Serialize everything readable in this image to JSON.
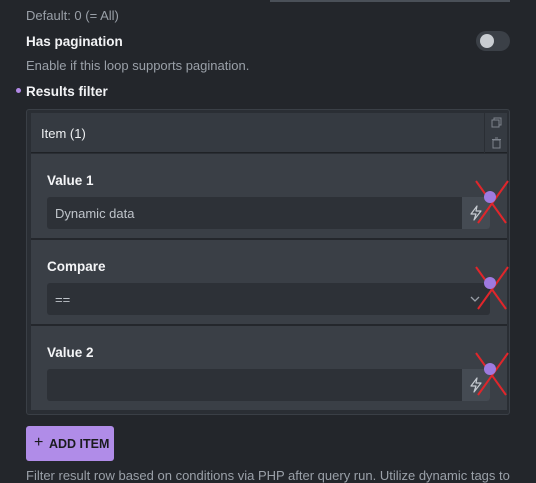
{
  "top": {
    "default_text": "Default: 0 (= All)"
  },
  "pagination": {
    "label": "Has pagination",
    "description": "Enable if this loop supports pagination.",
    "enabled": false
  },
  "results_filter": {
    "label": "Results filter",
    "item_title": "Item (1)",
    "fields": [
      {
        "label": "Value 1",
        "value": "Dynamic data",
        "has_dynamic_button": true
      },
      {
        "label": "Compare",
        "value": "==",
        "has_dynamic_button": false
      },
      {
        "label": "Value 2",
        "value": "",
        "has_dynamic_button": true
      }
    ],
    "add_item_label": "ADD ITEM"
  },
  "footer_text": "Filter result row based on conditions via PHP after query run. Utilize dynamic tags to",
  "colors": {
    "accent": "#b08ce8",
    "background": "#23262b",
    "panel": "#3a3f46"
  },
  "icons": [
    "duplicate-icon",
    "trash-icon",
    "bolt-icon",
    "chevron-down-icon",
    "plus-icon"
  ]
}
